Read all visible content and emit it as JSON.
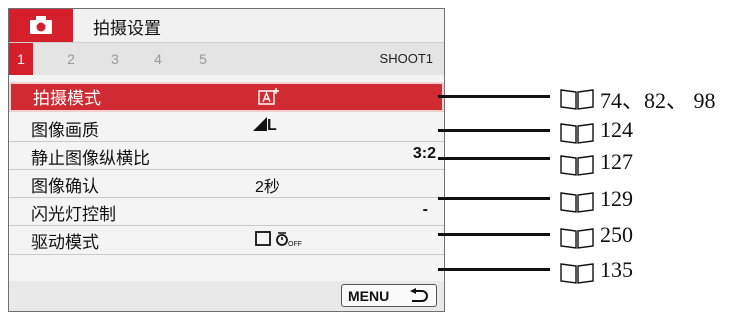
{
  "header": {
    "title": "拍摄设置",
    "camera_icon": "camera-icon"
  },
  "tabs": [
    "1",
    "2",
    "3",
    "4",
    "5"
  ],
  "active_tab": "1",
  "page_name": "SHOOT1",
  "menu_items": [
    {
      "label": "拍摄模式",
      "value": "A+",
      "value_icon": "scene-intelligent-auto-icon",
      "page_refs": "74、82、 98",
      "selected": true
    },
    {
      "label": "图像画质",
      "value": "L",
      "value_icon": "quality-large-fine-icon",
      "page_refs": "124",
      "selected": false
    },
    {
      "label": "静止图像纵横比",
      "value": "3:2",
      "page_refs": "127",
      "selected": false
    },
    {
      "label": "图像确认",
      "value": "2秒",
      "page_refs": "129",
      "selected": false
    },
    {
      "label": "闪光灯控制",
      "value": "-",
      "page_refs": "250",
      "selected": false
    },
    {
      "label": "驱动模式",
      "value": "",
      "value_icon": "single-shot-self-timer-off-icon",
      "page_refs": "135",
      "selected": false
    }
  ],
  "footer": {
    "menu_button_label": "MENU",
    "back_icon": "return-arrow-icon"
  },
  "reference_icon": "book-icon",
  "colors": {
    "accent": "#d51f2a",
    "selected_row": "#d02a33",
    "panel_bg": "#f4f4f4"
  }
}
